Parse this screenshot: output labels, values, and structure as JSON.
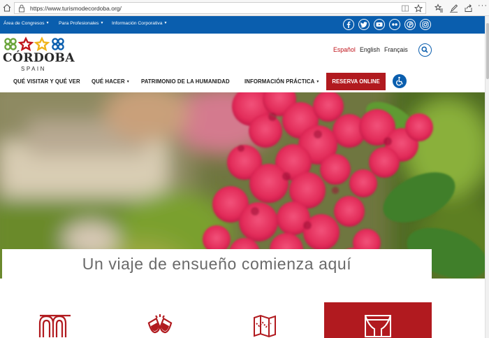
{
  "browser": {
    "url": "https://www.turismodecordoba.org/"
  },
  "topbar": {
    "items": [
      {
        "label": "Área de Congresos"
      },
      {
        "label": "Para Profesionales"
      },
      {
        "label": "Información Corporativa"
      }
    ],
    "social": [
      "facebook-icon",
      "twitter-icon",
      "youtube-icon",
      "flickr-icon",
      "pinterest-icon",
      "instagram-icon"
    ]
  },
  "logo": {
    "wordmark": "CÓRDOBA",
    "subtitle": "SPAIN"
  },
  "languages": [
    {
      "label": "Español"
    },
    {
      "label": "English"
    },
    {
      "label": "Français"
    }
  ],
  "mainnav": {
    "items": [
      {
        "label": "QUÉ VISITAR Y QUÉ VER"
      },
      {
        "label": "QUÉ HACER"
      },
      {
        "label": "PATRIMONIO DE LA HUMANIDAD"
      },
      {
        "label": "INFORMACIÓN PRÁCTICA"
      }
    ],
    "reserve_label": "RESERVA ONLINE"
  },
  "hero": {
    "tagline": "Un viaje de ensueño comienza aquí"
  },
  "tiles": [
    "arches-icon",
    "wine-toast-icon",
    "map-icon",
    "theater-icon"
  ],
  "colors": {
    "brand_blue": "#0a5eae",
    "brand_red": "#b11a1f",
    "active_language": "#c0141b"
  }
}
